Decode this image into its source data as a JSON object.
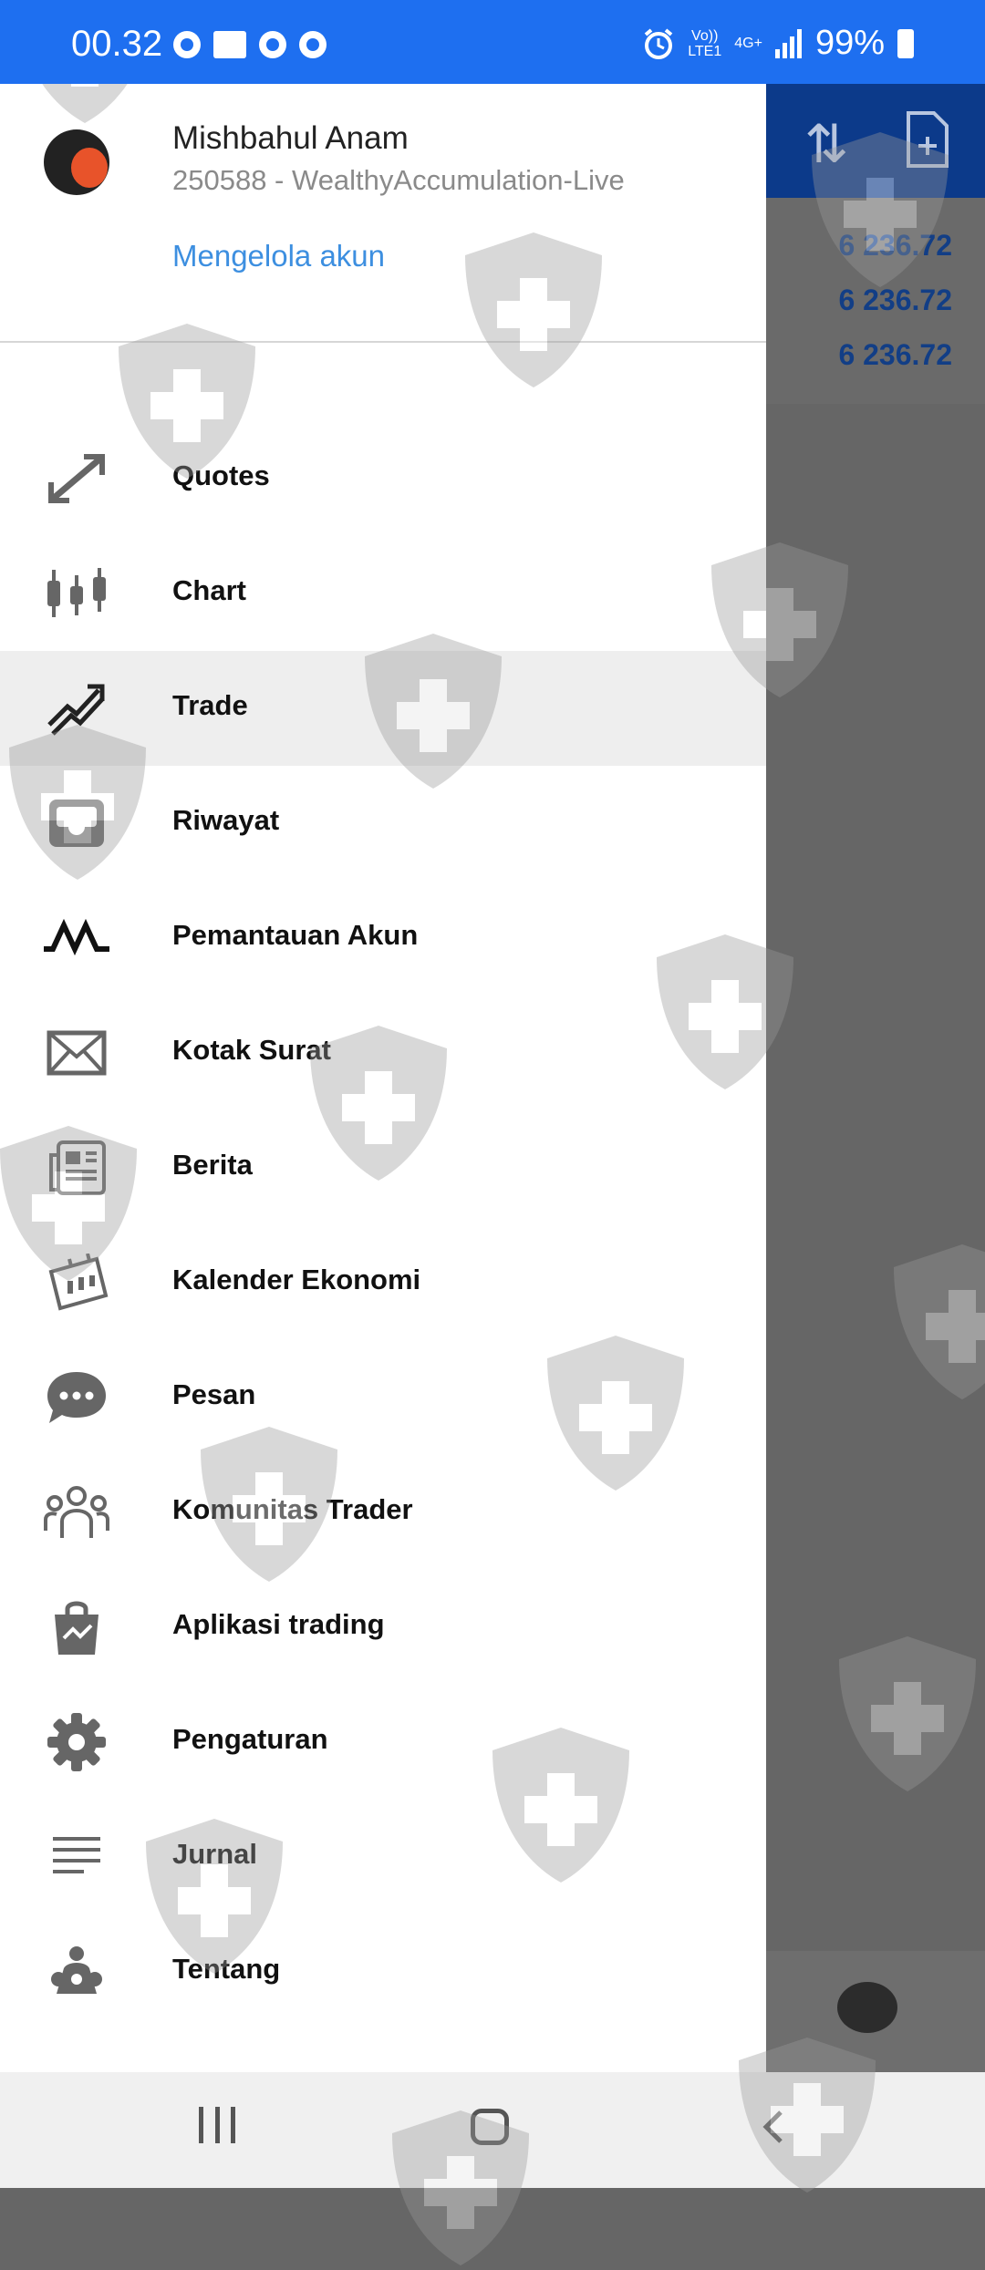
{
  "status_bar": {
    "time": "00.32",
    "net_top": "Vo))",
    "net_bottom": "LTE1",
    "net_type": "4G+",
    "battery": "99%"
  },
  "background": {
    "rows": [
      "6 236.72",
      "6 236.72",
      "6 236.72"
    ]
  },
  "account": {
    "name": "Mishbahul Anam",
    "detail": "250588 - WealthyAccumulation-Live",
    "manage_label": "Mengelola akun"
  },
  "menu": {
    "items": [
      {
        "label": "Quotes",
        "icon": "quotes-icon"
      },
      {
        "label": "Chart",
        "icon": "chart-icon"
      },
      {
        "label": "Trade",
        "icon": "trade-icon",
        "active": true
      },
      {
        "label": "Riwayat",
        "icon": "history-icon"
      },
      {
        "label": "Pemantauan Akun",
        "icon": "monitoring-icon"
      },
      {
        "label": "Kotak Surat",
        "icon": "mailbox-icon"
      },
      {
        "label": "Berita",
        "icon": "news-icon"
      },
      {
        "label": "Kalender Ekonomi",
        "icon": "calendar-icon"
      },
      {
        "label": "Pesan",
        "icon": "messages-icon"
      },
      {
        "label": "Komunitas Trader",
        "icon": "community-icon"
      },
      {
        "label": "Aplikasi trading",
        "icon": "trading-apps-icon"
      },
      {
        "label": "Pengaturan",
        "icon": "settings-icon"
      },
      {
        "label": "Jurnal",
        "icon": "journal-icon"
      },
      {
        "label": "Tentang",
        "icon": "about-icon"
      }
    ]
  },
  "colors": {
    "status_bar": "#1e6ff0",
    "accent": "#3d8fe0",
    "active_row": "#eeeeee",
    "header_dark": "#0c3a8a"
  }
}
